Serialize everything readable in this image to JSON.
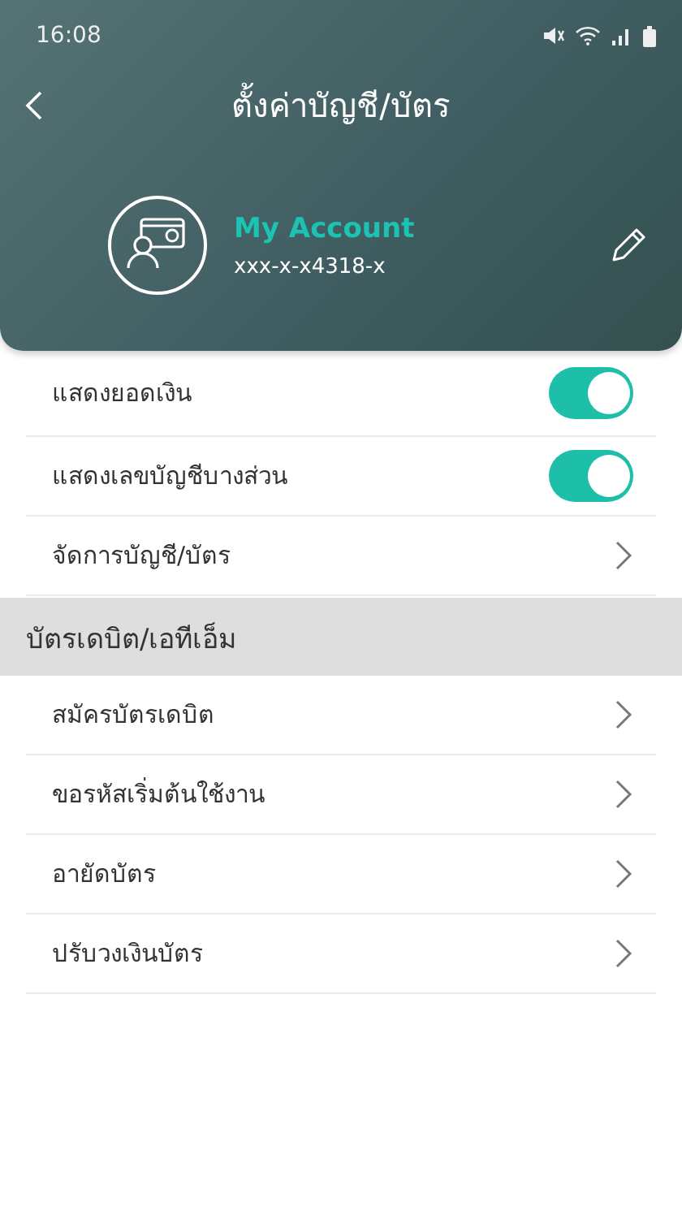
{
  "status_bar": {
    "time": "16:08"
  },
  "header": {
    "title": "ตั้งค่าบัญชี/บัตร"
  },
  "account": {
    "name": "My Account",
    "number": "xxx-x-x4318-x"
  },
  "settings": [
    {
      "kind": "toggle",
      "label": "แสดงยอดเงิน",
      "on": true
    },
    {
      "kind": "toggle",
      "label": "แสดงเลขบัญชีบางส่วน",
      "on": true
    },
    {
      "kind": "link",
      "label": "จัดการบัญชี/บัตร"
    }
  ],
  "section": {
    "title": "บัตรเดบิต/เอทีเอ็ม",
    "items": [
      {
        "kind": "link",
        "label": "สมัครบัตรเดบิต"
      },
      {
        "kind": "link",
        "label": "ขอรหัสเริ่มต้นใช้งาน"
      },
      {
        "kind": "link",
        "label": "อายัดบัตร"
      },
      {
        "kind": "link",
        "label": "ปรับวงเงินบัตร"
      }
    ]
  }
}
